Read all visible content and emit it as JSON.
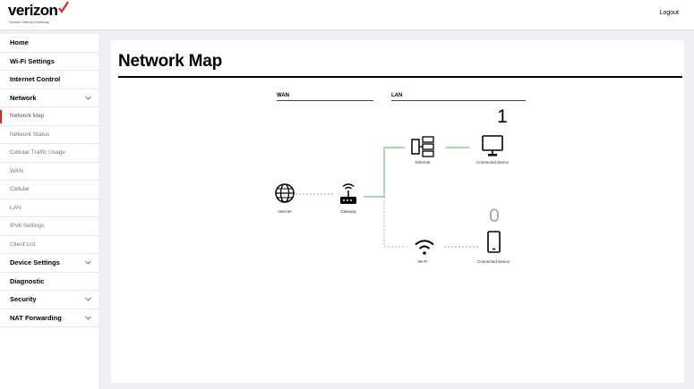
{
  "header": {
    "brand": "verizon",
    "brand_sub": "Verizon Internet Gateway",
    "logout_label": "Logout",
    "brand_check_color": "#d52b1e"
  },
  "sidebar": {
    "items": [
      {
        "label": "Home",
        "type": "parent"
      },
      {
        "label": "Wi-Fi Settings",
        "type": "parent"
      },
      {
        "label": "Internet Control",
        "type": "parent"
      },
      {
        "label": "Network",
        "type": "parent",
        "expanded": true
      },
      {
        "label": "Network Map",
        "type": "child",
        "active": true
      },
      {
        "label": "Network Status",
        "type": "child"
      },
      {
        "label": "Cellular Traffic Usage",
        "type": "child"
      },
      {
        "label": "WAN",
        "type": "child"
      },
      {
        "label": "Cellular",
        "type": "child"
      },
      {
        "label": "LAN",
        "type": "child"
      },
      {
        "label": "IPv6 Settings",
        "type": "child"
      },
      {
        "label": "Client List",
        "type": "child"
      },
      {
        "label": "Device Settings",
        "type": "parent"
      },
      {
        "label": "Diagnostic",
        "type": "parent"
      },
      {
        "label": "Security",
        "type": "parent"
      },
      {
        "label": "NAT Forwarding",
        "type": "parent"
      }
    ]
  },
  "main": {
    "title": "Network Map",
    "wan_label": "WAN",
    "lan_label": "LAN",
    "nodes": {
      "internet": "Internet",
      "gateway": "Gateway",
      "ethernet": "Ethernet",
      "wifi": "Wi-Fi",
      "wired_device": "Connected device",
      "wifi_device": "Connected device"
    },
    "wired_device_count": "1",
    "wifi_device_count": "0",
    "active_link_color": "#6cc57c"
  }
}
